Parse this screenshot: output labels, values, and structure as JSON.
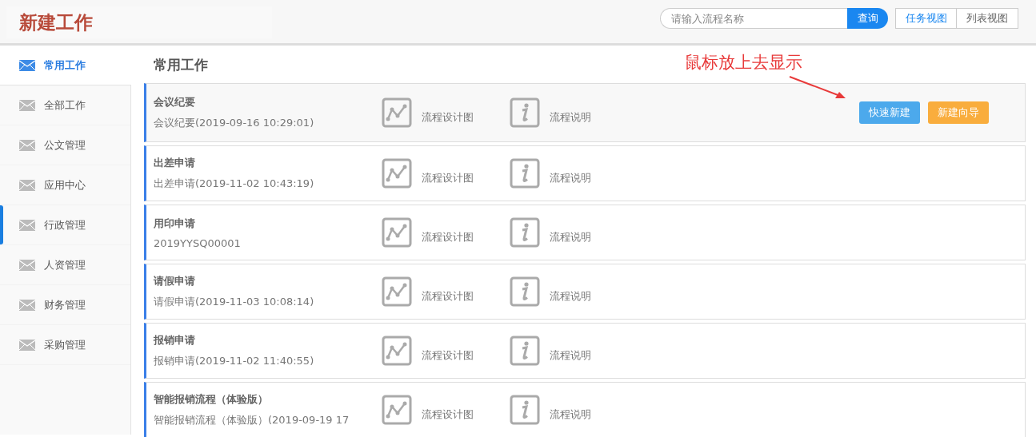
{
  "header": {
    "title": "新建工作",
    "search": {
      "placeholder": "请输入流程名称",
      "button": "查询"
    },
    "views": [
      {
        "label": "任务视图",
        "selected": true
      },
      {
        "label": "列表视图",
        "selected": false
      }
    ]
  },
  "sidebar": {
    "items": [
      {
        "label": "常用工作",
        "selected": true,
        "hovered": false
      },
      {
        "label": "全部工作",
        "selected": false,
        "hovered": false
      },
      {
        "label": "公文管理",
        "selected": false,
        "hovered": false
      },
      {
        "label": "应用中心",
        "selected": false,
        "hovered": false
      },
      {
        "label": "行政管理",
        "selected": false,
        "hovered": true
      },
      {
        "label": "人资管理",
        "selected": false,
        "hovered": false
      },
      {
        "label": "财务管理",
        "selected": false,
        "hovered": false
      },
      {
        "label": "采购管理",
        "selected": false,
        "hovered": false
      }
    ]
  },
  "main": {
    "title": "常用工作",
    "annotation": "鼠标放上去显示",
    "rows": [
      {
        "name": "会议纪要",
        "detail": "会议纪要(2019-09-16 10:29:01)",
        "hovered": true,
        "design": "流程设计图",
        "info": "流程说明",
        "buttons": [
          "快速新建",
          "新建向导"
        ]
      },
      {
        "name": "出差申请",
        "detail": "出差申请(2019-11-02 10:43:19)",
        "hovered": false,
        "design": "流程设计图",
        "info": "流程说明"
      },
      {
        "name": "用印申请",
        "detail": "2019YYSQ00001",
        "hovered": false,
        "design": "流程设计图",
        "info": "流程说明"
      },
      {
        "name": "请假申请",
        "detail": "请假申请(2019-11-03 10:08:14)",
        "hovered": false,
        "design": "流程设计图",
        "info": "流程说明"
      },
      {
        "name": "报销申请",
        "detail": "报销申请(2019-11-02 11:40:55)",
        "hovered": false,
        "design": "流程设计图",
        "info": "流程说明"
      },
      {
        "name": "智能报销流程（体验版）",
        "detail": "智能报销流程（体验版）(2019-09-19 17",
        "hovered": false,
        "design": "流程设计图",
        "info": "流程说明"
      }
    ]
  }
}
